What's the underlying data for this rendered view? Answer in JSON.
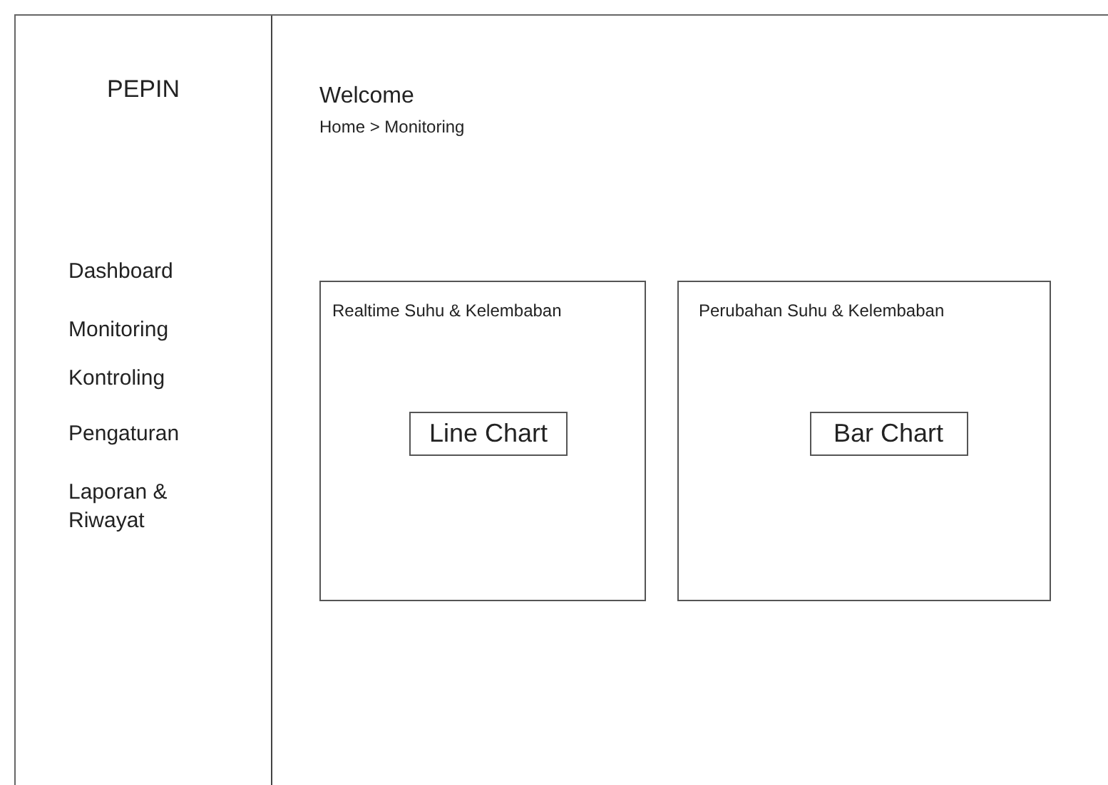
{
  "sidebar": {
    "logo": "PEPIN",
    "items": [
      "Dashboard",
      "Monitoring",
      "Kontroling",
      "Pengaturan",
      "Laporan & Riwayat"
    ]
  },
  "header": {
    "title": "Welcome",
    "breadcrumb": "Home > Monitoring"
  },
  "cards": [
    {
      "title": "Realtime Suhu & Kelembaban",
      "chart_label": "Line Chart"
    },
    {
      "title": "Perubahan Suhu & Kelembaban",
      "chart_label": "Bar Chart"
    }
  ]
}
